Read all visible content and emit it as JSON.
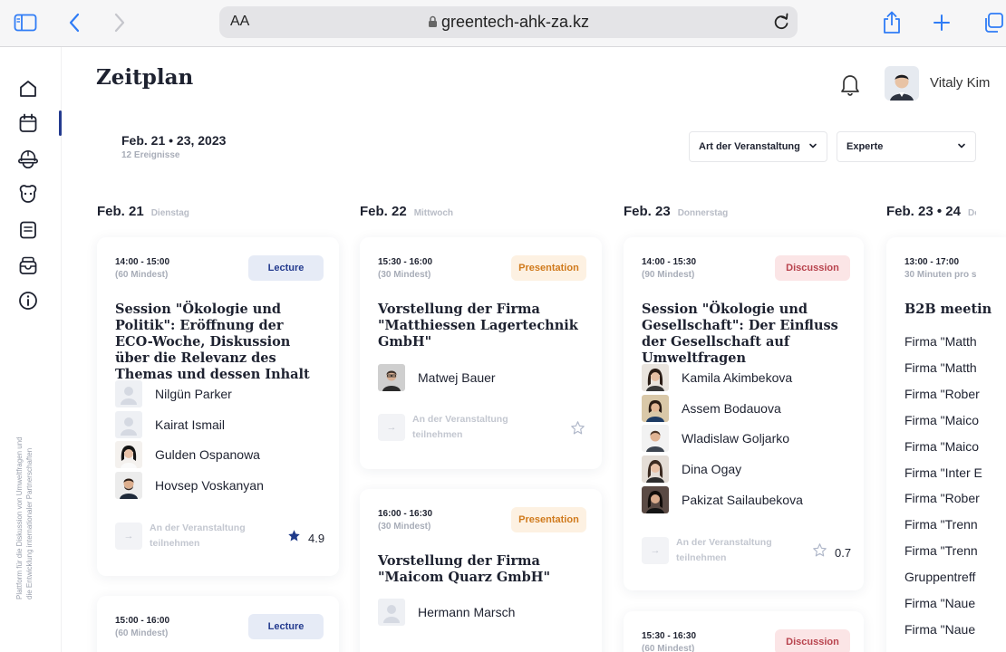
{
  "browser": {
    "text_size_label": "AA",
    "url": "greentech-ahk-za.kz"
  },
  "sidebar": {
    "footer_text": "Plattform für die Diskussion von Umweltfragen und die Entwicklung internationaler Partnerschaften"
  },
  "header": {
    "title": "Zeitplan",
    "user_name": "Vitaly Kim"
  },
  "summary": {
    "date_range": "Feb. 21 • 23, 2023",
    "events_count": "12 Ereignisse"
  },
  "filters": {
    "event_type": "Art der Veranstaltung",
    "expert": "Experte"
  },
  "join_label": "An der Veranstaltung teilnehmen",
  "days": [
    {
      "date": "Feb. 21",
      "weekday": "Dienstag",
      "events": [
        {
          "time": "14:00 - 15:00",
          "duration": "(60 Mindest)",
          "type": "Lecture",
          "title": "Session \"Ökologie und Politik\": Eröffnung der ECO-Woche, Diskussion über die Relevanz des Themas und dessen Inhalt",
          "speakers": [
            "Nilgün Parker",
            "Kairat Ismail",
            "Gulden Ospanowa",
            "Hovsep Voskanyan"
          ],
          "rating": "4.9"
        },
        {
          "time": "15:00 - 16:00",
          "duration": "(60 Mindest)",
          "type": "Lecture"
        }
      ]
    },
    {
      "date": "Feb. 22",
      "weekday": "Mittwoch",
      "events": [
        {
          "time": "15:30 - 16:00",
          "duration": "(30 Mindest)",
          "type": "Presentation",
          "title": "Vorstellung der Firma \"Matthiessen Lagertechnik GmbH\"",
          "speakers": [
            "Matwej Bauer"
          ]
        },
        {
          "time": "16:00 - 16:30",
          "duration": "(30 Mindest)",
          "type": "Presentation",
          "title": "Vorstellung der Firma \"Maicom Quarz GmbH\"",
          "speakers": [
            "Hermann Marsch"
          ]
        }
      ]
    },
    {
      "date": "Feb. 23",
      "weekday": "Donnerstag",
      "events": [
        {
          "time": "14:00 - 15:30",
          "duration": "(90 Mindest)",
          "type": "Discussion",
          "title": "Session \"Ökologie und Gesellschaft\": Der Einfluss der Gesellschaft auf Umweltfragen",
          "speakers": [
            "Kamila Akimbekova",
            "Assem Bodauova",
            "Wladislaw Goljarko",
            "Dina Ogay",
            "Pakizat Sailaubekova"
          ],
          "rating": "0.7"
        },
        {
          "time": "15:30 - 16:30",
          "duration": "(60 Mindest)",
          "type": "Discussion"
        }
      ]
    },
    {
      "date": "Feb. 23 • 24",
      "weekday": "Do",
      "events": [
        {
          "time": "13:00 - 17:00",
          "duration": "30 Minuten pro s",
          "title": "B2B meetin",
          "lines": [
            "Firma \"Matth",
            "Firma \"Matth",
            "Firma \"Rober",
            "Firma \"Maico",
            "Firma \"Maico",
            "Firma \"Inter E",
            "Firma \"Rober",
            "Firma \"Trenn",
            "Firma \"Trenn",
            "Gruppentreff",
            "Firma \"Naue",
            "Firma \"Naue"
          ]
        }
      ]
    }
  ]
}
